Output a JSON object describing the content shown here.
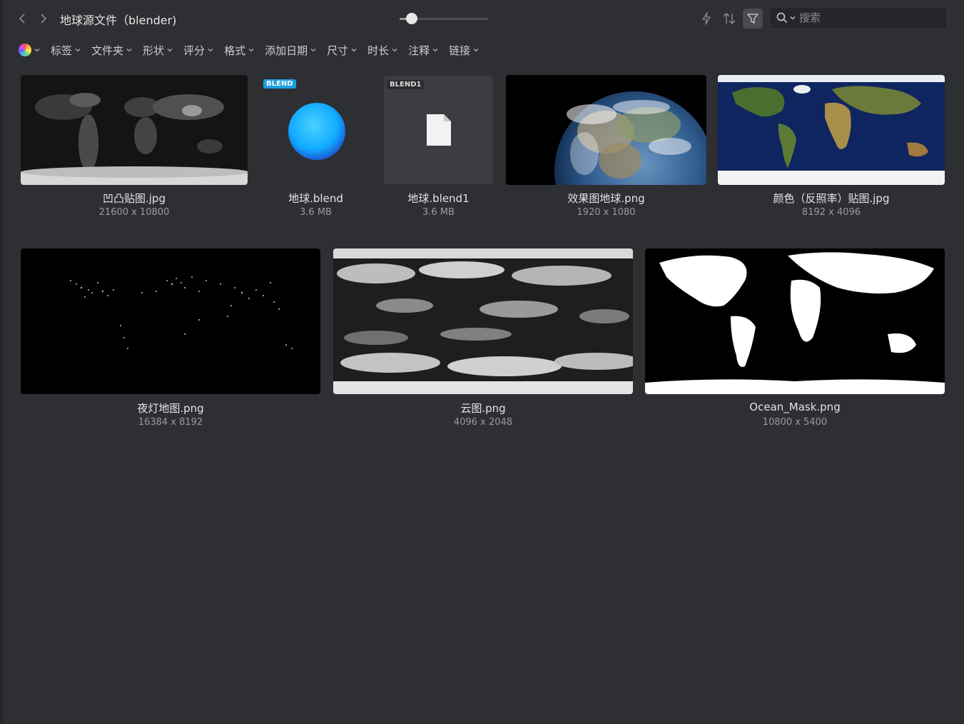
{
  "header": {
    "title": "地球源文件（blender)",
    "zoom_fraction": 0.14,
    "search_placeholder": "搜索"
  },
  "filters": [
    "标签",
    "文件夹",
    "形状",
    "评分",
    "格式",
    "添加日期",
    "尺寸",
    "时长",
    "注释",
    "链接"
  ],
  "items": [
    {
      "name": "凹凸贴图.jpg",
      "meta": "21600 x 10800"
    },
    {
      "name": "地球.blend",
      "meta": "3.6 MB",
      "badge": "BLEND"
    },
    {
      "name": "地球.blend1",
      "meta": "3.6 MB",
      "badge": "BLEND1"
    },
    {
      "name": "效果图地球.png",
      "meta": "1920 x 1080"
    },
    {
      "name": "颜色（反照率）贴图.jpg",
      "meta": "8192 x 4096"
    },
    {
      "name": "夜灯地图.png",
      "meta": "16384 x 8192"
    },
    {
      "name": "云图.png",
      "meta": "4096 x 2048"
    },
    {
      "name": "Ocean_Mask.png",
      "meta": "10800 x 5400"
    }
  ],
  "colors": {
    "background": "#2e2f33",
    "accent": "#1a9fe0",
    "text": "#e4e4e4",
    "muted": "#9a9ba0"
  }
}
